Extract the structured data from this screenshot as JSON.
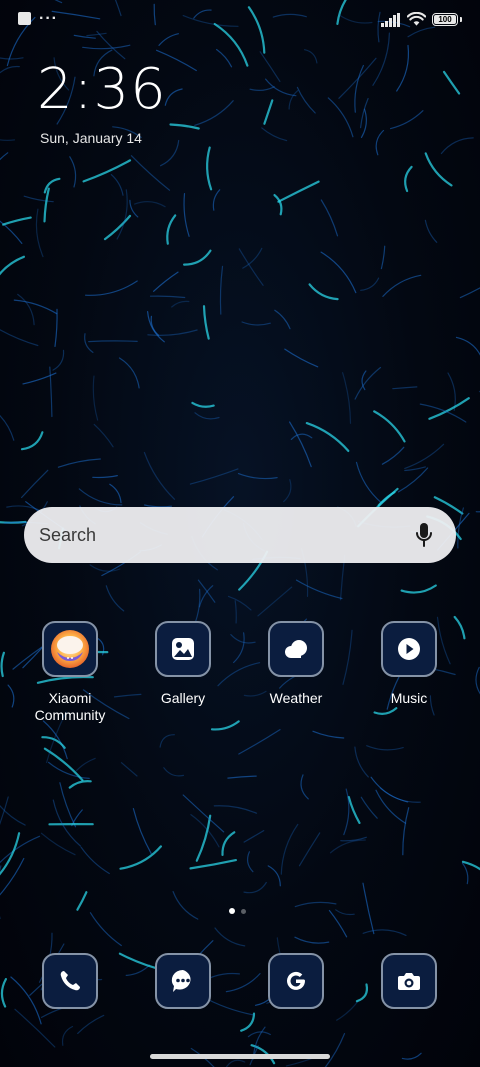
{
  "status_bar": {
    "battery_level": "100",
    "icons": [
      "notification-square-icon",
      "more-dots-icon",
      "signal-icon",
      "wifi-icon",
      "battery-icon"
    ]
  },
  "clock": {
    "time": "2:36",
    "date": "Sun, January 14"
  },
  "search": {
    "placeholder": "Search",
    "icon": "microphone-icon"
  },
  "apps": [
    {
      "label": "Xiaomi\nCommunity",
      "icon": "xiaomi-community-icon"
    },
    {
      "label": "Gallery",
      "icon": "gallery-icon"
    },
    {
      "label": "Weather",
      "icon": "weather-icon"
    },
    {
      "label": "Music",
      "icon": "music-icon"
    }
  ],
  "pages": {
    "current": 1,
    "total": 2
  },
  "dock": [
    {
      "name": "Phone",
      "icon": "phone-icon"
    },
    {
      "name": "Messages",
      "icon": "message-icon"
    },
    {
      "name": "Google",
      "icon": "google-icon"
    },
    {
      "name": "Camera",
      "icon": "camera-icon"
    }
  ],
  "colors": {
    "tile_background": "#0b1d3f",
    "tile_border": "#8593a7",
    "wallpaper_accent": "#29d3e6",
    "wallpaper_line": "#1c6fd0"
  }
}
